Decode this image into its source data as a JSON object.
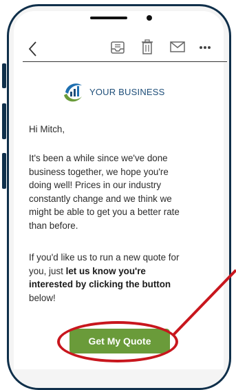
{
  "toolbar": {
    "back_icon": "chevron-left-icon",
    "icons": [
      "inbox-icon",
      "trash-icon",
      "mail-icon",
      "more-icon"
    ]
  },
  "brand": {
    "name": "YOUR BUSINESS",
    "color": "#1e4e79",
    "accent": "#6a9b3a"
  },
  "email": {
    "greeting": "Hi Mitch,",
    "para1_lines": [
      "It's been a while since we've done",
      "business together, we hope you're",
      "doing well! Prices in our industry",
      "constantly change and we think we",
      "might be able to get you a better rate",
      "than before."
    ],
    "para2_line1": "If you'd like us to run a new quote for",
    "para2_line2_plain": "you, just ",
    "para2_line2_bold": "let us know you're",
    "para2_line3_bold": "interested by clicking the button",
    "para2_line4": "below!",
    "cta_label": "Get My Quote"
  },
  "highlight_color": "#c8161d"
}
